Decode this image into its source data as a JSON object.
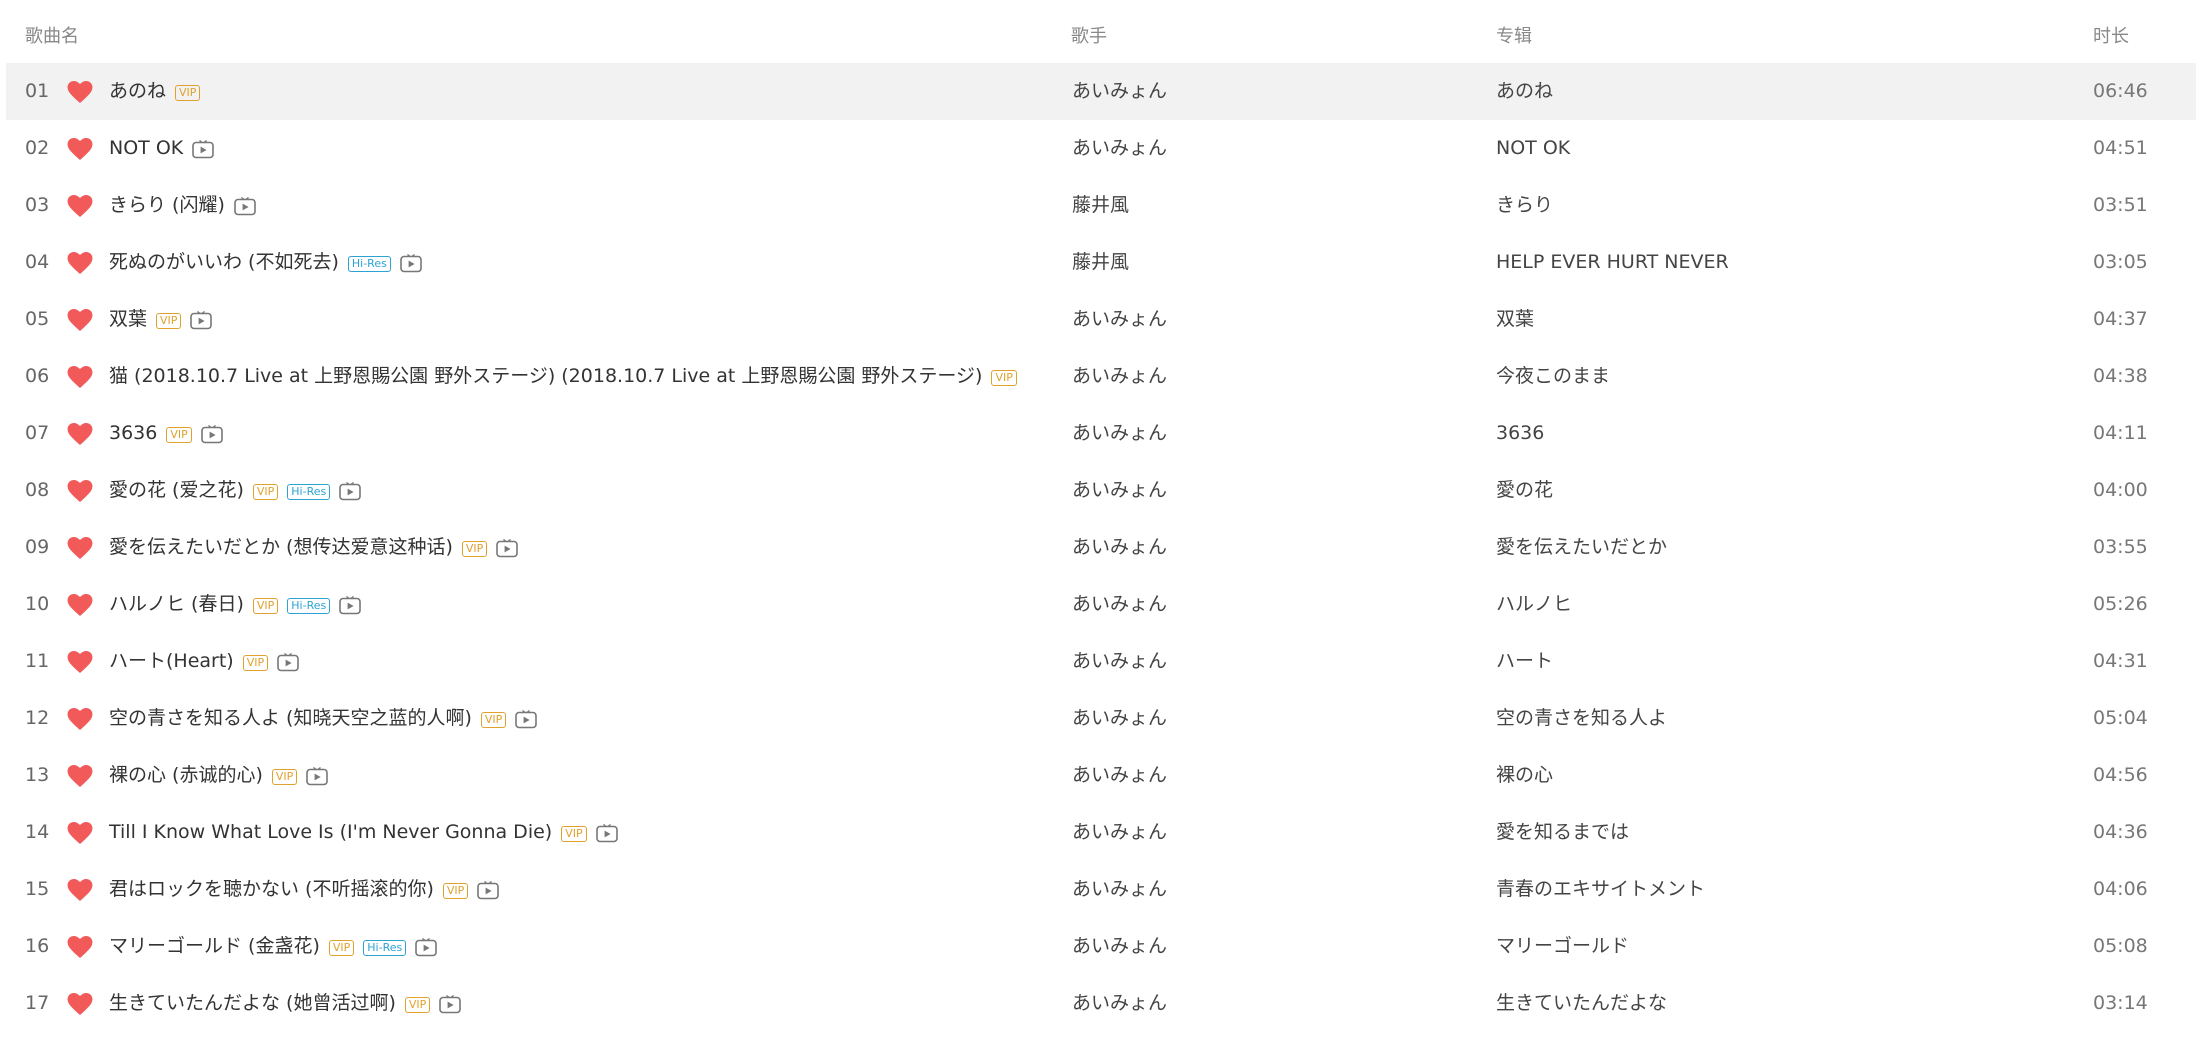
{
  "header": {
    "song": "歌曲名",
    "artist": "歌手",
    "album": "专辑",
    "duration": "时长"
  },
  "colors": {
    "heart": "#f25a5a",
    "vip_badge": "#e0a22d",
    "hires_badge": "#2da3d4",
    "row_highlight": "#f2f2f2"
  },
  "badge_labels": {
    "vip": "VIP",
    "hires": "Hi-Res"
  },
  "icons": {
    "like": "heart-icon",
    "mv": "mv-play-icon"
  },
  "songs": [
    {
      "num": "01",
      "title": "あのね",
      "vip": true,
      "hires": false,
      "mv": false,
      "artist": "あいみょん",
      "album": "あのね",
      "duration": "06:46",
      "highlighted": true
    },
    {
      "num": "02",
      "title": "NOT OK",
      "vip": false,
      "hires": false,
      "mv": true,
      "artist": "あいみょん",
      "album": "NOT OK",
      "duration": "04:51"
    },
    {
      "num": "03",
      "title": "きらり (闪耀)",
      "vip": false,
      "hires": false,
      "mv": true,
      "artist": "藤井風",
      "album": "きらり",
      "duration": "03:51"
    },
    {
      "num": "04",
      "title": "死ぬのがいいわ (不如死去)",
      "vip": false,
      "hires": true,
      "mv": true,
      "artist": "藤井風",
      "album": "HELP EVER HURT NEVER",
      "duration": "03:05"
    },
    {
      "num": "05",
      "title": "双葉",
      "vip": true,
      "hires": false,
      "mv": true,
      "artist": "あいみょん",
      "album": "双葉",
      "duration": "04:37"
    },
    {
      "num": "06",
      "title": "猫 (2018.10.7 Live at 上野恩賜公園 野外ステージ) (2018.10.7 Live at 上野恩賜公園 野外ステージ)",
      "vip": true,
      "hires": false,
      "mv": false,
      "artist": "あいみょん",
      "album": "今夜このまま",
      "duration": "04:38"
    },
    {
      "num": "07",
      "title": "3636",
      "vip": true,
      "hires": false,
      "mv": true,
      "artist": "あいみょん",
      "album": "3636",
      "duration": "04:11"
    },
    {
      "num": "08",
      "title": "愛の花 (爱之花)",
      "vip": true,
      "hires": true,
      "mv": true,
      "artist": "あいみょん",
      "album": "愛の花",
      "duration": "04:00"
    },
    {
      "num": "09",
      "title": "愛を伝えたいだとか (想传达爱意这种话)",
      "vip": true,
      "hires": false,
      "mv": true,
      "artist": "あいみょん",
      "album": "愛を伝えたいだとか",
      "duration": "03:55"
    },
    {
      "num": "10",
      "title": "ハルノヒ (春日)",
      "vip": true,
      "hires": true,
      "mv": true,
      "artist": "あいみょん",
      "album": "ハルノヒ",
      "duration": "05:26"
    },
    {
      "num": "11",
      "title": "ハート(Heart)",
      "vip": true,
      "hires": false,
      "mv": true,
      "artist": "あいみょん",
      "album": "ハート",
      "duration": "04:31"
    },
    {
      "num": "12",
      "title": "空の青さを知る人よ (知晓天空之蓝的人啊)",
      "vip": true,
      "hires": false,
      "mv": true,
      "artist": "あいみょん",
      "album": "空の青さを知る人よ",
      "duration": "05:04"
    },
    {
      "num": "13",
      "title": "裸の心 (赤诚的心)",
      "vip": true,
      "hires": false,
      "mv": true,
      "artist": "あいみょん",
      "album": "裸の心",
      "duration": "04:56"
    },
    {
      "num": "14",
      "title": "Till I Know What Love Is (I'm Never Gonna Die)",
      "vip": true,
      "hires": false,
      "mv": true,
      "artist": "あいみょん",
      "album": "愛を知るまでは",
      "duration": "04:36"
    },
    {
      "num": "15",
      "title": "君はロックを聴かない (不听摇滚的你)",
      "vip": true,
      "hires": false,
      "mv": true,
      "artist": "あいみょん",
      "album": "青春のエキサイトメント",
      "duration": "04:06"
    },
    {
      "num": "16",
      "title": "マリーゴールド (金盏花)",
      "vip": true,
      "hires": true,
      "mv": true,
      "artist": "あいみょん",
      "album": "マリーゴールド",
      "duration": "05:08"
    },
    {
      "num": "17",
      "title": "生きていたんだよな (她曾活过啊)",
      "vip": true,
      "hires": false,
      "mv": true,
      "artist": "あいみょん",
      "album": "生きていたんだよな",
      "duration": "03:14"
    }
  ]
}
